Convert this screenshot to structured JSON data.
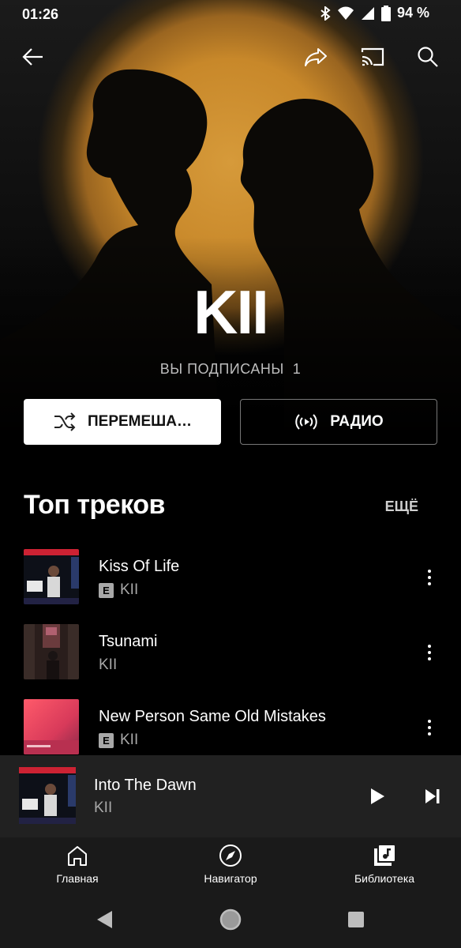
{
  "status": {
    "time": "01:26",
    "battery": "94 %"
  },
  "artist": {
    "name": "KII",
    "subscribers_label": "ВЫ ПОДПИСАНЫ",
    "subscribers_count": "1"
  },
  "actions": {
    "shuffle_label": "ПЕРЕМЕША…",
    "radio_label": "РАДИО"
  },
  "top_tracks": {
    "title": "Топ треков",
    "more_label": "ЕЩЁ",
    "explicit_badge": "E",
    "items": [
      {
        "title": "Kiss Of Life",
        "artist": "KII",
        "explicit": true
      },
      {
        "title": "Tsunami",
        "artist": "KII",
        "explicit": false
      },
      {
        "title": "New Person Same Old Mistakes",
        "artist": "KII",
        "explicit": true
      }
    ]
  },
  "now_playing": {
    "title": "Into The Dawn",
    "artist": "KII"
  },
  "bottom_nav": {
    "home": "Главная",
    "explore": "Навигатор",
    "library": "Библиотека"
  },
  "colors": {
    "hero_glow": "#d69a3a",
    "mini_player_bg": "#212121",
    "nav_bg": "#1a1a1a"
  }
}
